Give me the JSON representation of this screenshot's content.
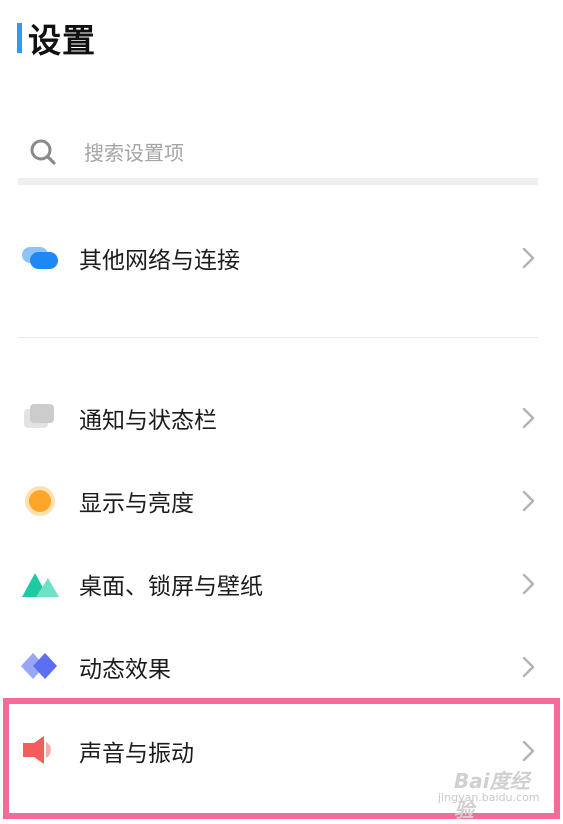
{
  "header": {
    "title": "设置"
  },
  "search": {
    "placeholder": "搜索设置项"
  },
  "items": [
    {
      "label": "其他网络与连接",
      "icon": "network-connection-icon"
    },
    {
      "label": "通知与状态栏",
      "icon": "notification-icon"
    },
    {
      "label": "显示与亮度",
      "icon": "display-brightness-icon"
    },
    {
      "label": "桌面、锁屏与壁纸",
      "icon": "wallpaper-icon"
    },
    {
      "label": "动态效果",
      "icon": "motion-effects-icon"
    },
    {
      "label": "声音与振动",
      "icon": "sound-vibration-icon"
    }
  ],
  "watermark": {
    "brand": "Bai度经验",
    "site": "jingyan.baidu.com"
  },
  "colors": {
    "accent": "#2f9bf5",
    "highlight": "#f56b97",
    "network": "#1e88f5",
    "display": "#fda62a",
    "wallpaper": "#1fc9a2",
    "motion": "#5b6ff2",
    "sound": "#f55d5d"
  }
}
